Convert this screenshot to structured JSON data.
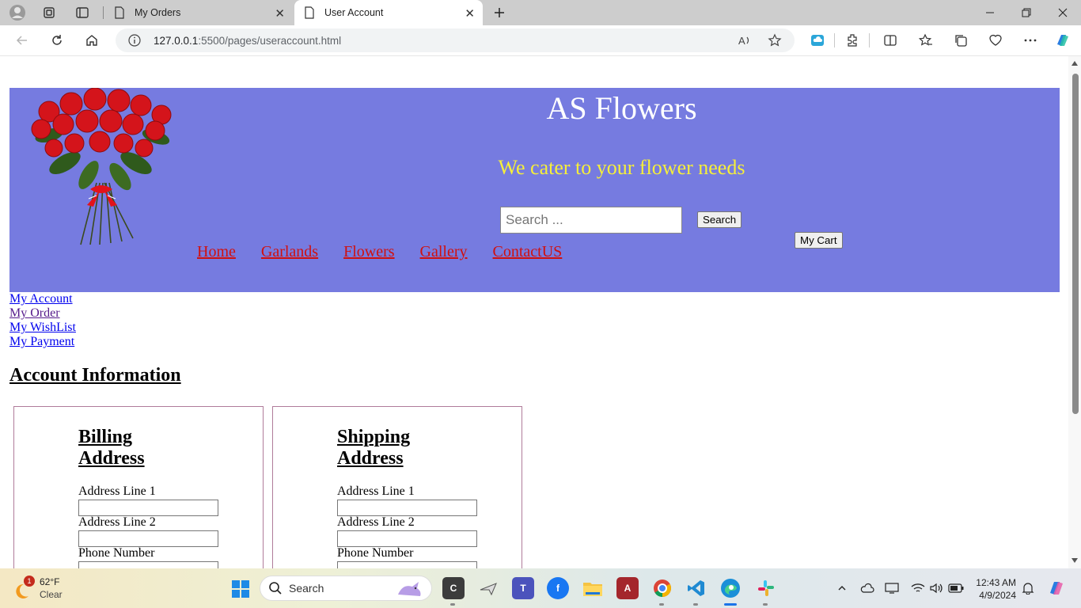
{
  "browser": {
    "tabs": [
      {
        "title": "My Orders",
        "active": false
      },
      {
        "title": "User Account",
        "active": true
      }
    ],
    "url_host": "127.0.0.1",
    "url_path": ":5500/pages/useraccount.html"
  },
  "site": {
    "title": "AS Flowers",
    "tagline": "We cater to your flower needs",
    "search_placeholder": "Search ...",
    "search_button": "Search",
    "cart_button": "My Cart",
    "menu": [
      "Home",
      "Garlands",
      "Flowers",
      "Gallery",
      "ContactUS"
    ]
  },
  "sidebar": {
    "links": [
      "My Account",
      "My Order",
      "My WishList",
      "My Payment"
    ]
  },
  "account": {
    "heading": "Account Information",
    "billing": {
      "title": "Billing Address",
      "fields": [
        "Address Line 1",
        "Address Line 2",
        "Phone Number"
      ]
    },
    "shipping": {
      "title": "Shipping Address",
      "fields": [
        "Address Line 1",
        "Address Line 2",
        "Phone Number"
      ]
    }
  },
  "taskbar": {
    "weather_temp": "62°F",
    "weather_cond": "Clear",
    "weather_badge": "1",
    "search_label": "Search",
    "time": "12:43 AM",
    "date": "4/9/2024"
  },
  "colors": {
    "hero_bg": "#767be0",
    "tagline": "#f6ef39",
    "menu_link": "#d01010"
  }
}
